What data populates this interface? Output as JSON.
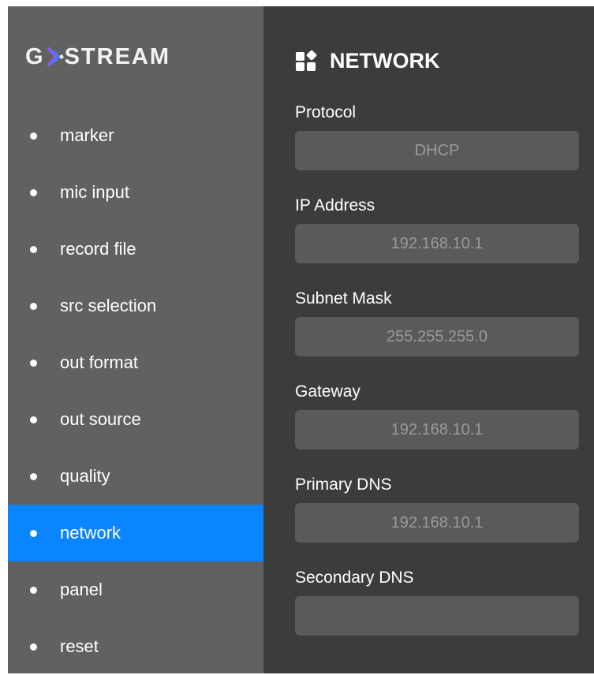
{
  "brand": {
    "logo_prefix": "G",
    "logo_suffix": "STREAM",
    "logo_accent_color": "#8b5cf6",
    "logo_accent_color_2": "#3b82f6"
  },
  "sidebar": {
    "items": [
      {
        "label": "marker",
        "active": false
      },
      {
        "label": "mic input",
        "active": false
      },
      {
        "label": "record file",
        "active": false
      },
      {
        "label": "src selection",
        "active": false
      },
      {
        "label": "out format",
        "active": false
      },
      {
        "label": "out source",
        "active": false
      },
      {
        "label": "quality",
        "active": false
      },
      {
        "label": "network",
        "active": true
      },
      {
        "label": "panel",
        "active": false
      },
      {
        "label": "reset",
        "active": false
      }
    ],
    "active_color": "#0a84ff"
  },
  "main": {
    "title": "NETWORK",
    "title_icon": "grid-icon",
    "fields": [
      {
        "label": "Protocol",
        "value": "DHCP"
      },
      {
        "label": "IP Address",
        "value": "192.168.10.1"
      },
      {
        "label": "Subnet Mask",
        "value": "255.255.255.0"
      },
      {
        "label": "Gateway",
        "value": "192.168.10.1"
      },
      {
        "label": "Primary DNS",
        "value": "192.168.10.1"
      },
      {
        "label": "Secondary DNS",
        "value": ""
      }
    ]
  }
}
